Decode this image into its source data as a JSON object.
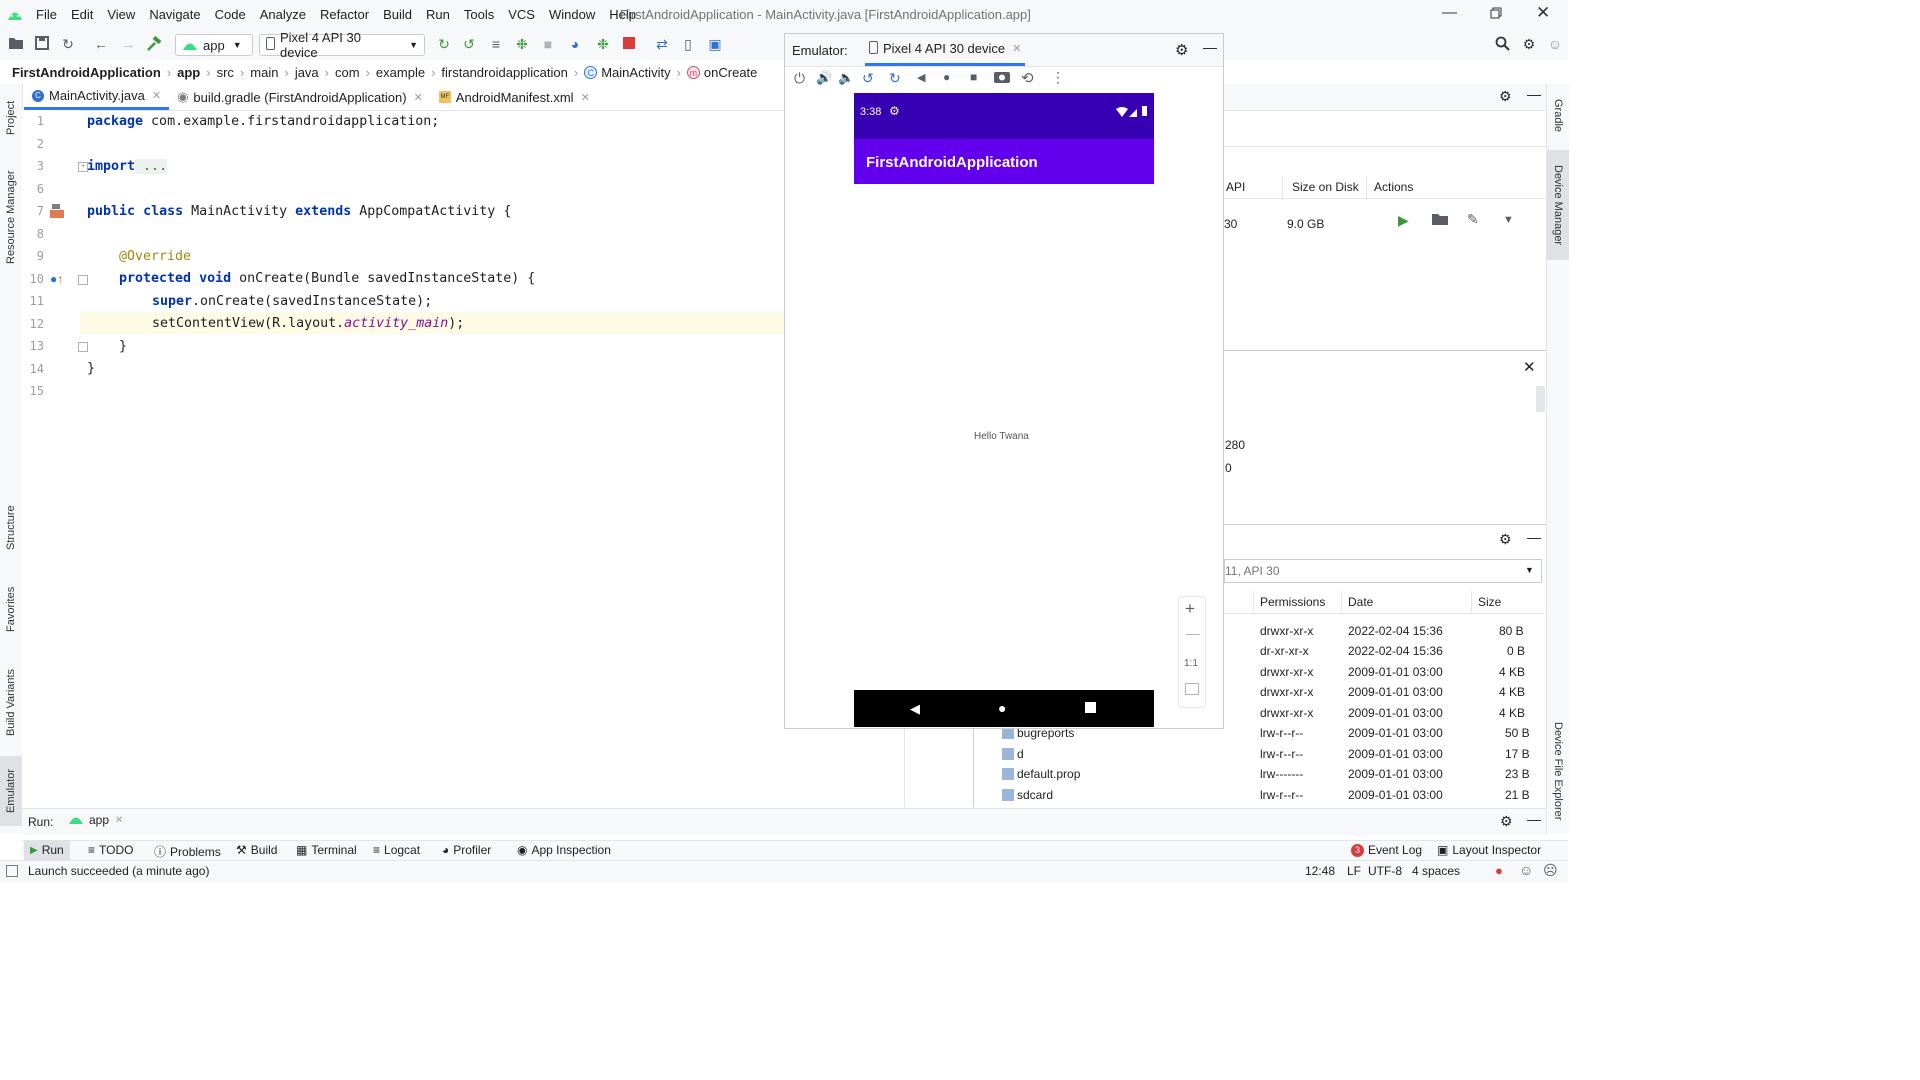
{
  "menu": [
    "File",
    "Edit",
    "View",
    "Navigate",
    "Code",
    "Analyze",
    "Refactor",
    "Build",
    "Run",
    "Tools",
    "VCS",
    "Window",
    "Help"
  ],
  "window_title": "FirstAndroidApplication - MainActivity.java [FirstAndroidApplication.app]",
  "toolbar": {
    "module": "app",
    "device": "Pixel 4 API 30 device"
  },
  "breadcrumb": [
    "FirstAndroidApplication",
    "app",
    "src",
    "main",
    "java",
    "com",
    "example",
    "firstandroidapplication",
    "MainActivity",
    "onCreate"
  ],
  "tabs": [
    "MainActivity.java",
    "build.gradle (FirstAndroidApplication)",
    "AndroidManifest.xml"
  ],
  "left_tools": [
    "Project",
    "Resource Manager",
    "Structure",
    "Favorites",
    "Build Variants",
    "Emulator"
  ],
  "right_tools": [
    "Gradle",
    "Device Manager",
    "Device File Explorer"
  ],
  "code": {
    "line_numbers": [
      "1",
      "2",
      "3",
      "6",
      "7",
      "8",
      "9",
      "10",
      "11",
      "12",
      "13",
      "14",
      "15"
    ],
    "l1_kw": "package",
    "l1_rest": " com.example.firstandroidapplication;",
    "l3_kw": "import",
    "l3_rest": " ...",
    "l7_kw1": "public",
    "l7_kw2": "class",
    "l7_mid": " MainActivity ",
    "l7_kw3": "extends",
    "l7_rest": " AppCompatActivity {",
    "l9_ann": "@Override",
    "l10_kw1": "protected",
    "l10_kw2": "void",
    "l10_rest": " onCreate(Bundle savedInstanceState) {",
    "l11_kw": "super",
    "l11_rest": ".onCreate(savedInstanceState);",
    "l12_pre": "setContentView(R.layout.",
    "l12_ital": "activity_main",
    "l12_post": ");",
    "l13": "}",
    "l14": "}"
  },
  "emulator": {
    "label": "Emulator:",
    "tab": "Pixel 4 API 30 device",
    "time": "3:38",
    "app_title": "FirstAndroidApplication",
    "hello": "Hello Twana",
    "zoom_ratio": "1:1"
  },
  "device_manager": {
    "columns": [
      "API",
      "Size on Disk",
      "Actions"
    ],
    "api_partial": "30",
    "size": "9.0 GB",
    "prop_a": "280",
    "prop_b": "0"
  },
  "file_explorer": {
    "device_select": "11, API 30",
    "columns": [
      "Permissions",
      "Date",
      "Size"
    ],
    "rows": [
      {
        "name": "",
        "perm": "drwxr-xr-x",
        "date": "2022-02-04 15:36",
        "size": "80 B"
      },
      {
        "name": "",
        "perm": "dr-xr-xr-x",
        "date": "2022-02-04 15:36",
        "size": "0 B"
      },
      {
        "name": "",
        "perm": "drwxr-xr-x",
        "date": "2009-01-01 03:00",
        "size": "4 KB"
      },
      {
        "name": "",
        "perm": "drwxr-xr-x",
        "date": "2009-01-01 03:00",
        "size": "4 KB"
      },
      {
        "name": "",
        "perm": "drwxr-xr-x",
        "date": "2009-01-01 03:00",
        "size": "4 KB"
      },
      {
        "name": "bugreports",
        "perm": "lrw-r--r--",
        "date": "2009-01-01 03:00",
        "size": "50 B"
      },
      {
        "name": "d",
        "perm": "lrw-r--r--",
        "date": "2009-01-01 03:00",
        "size": "17 B"
      },
      {
        "name": "default.prop",
        "perm": "lrw-------",
        "date": "2009-01-01 03:00",
        "size": "23 B"
      },
      {
        "name": "sdcard",
        "perm": "lrw-r--r--",
        "date": "2009-01-01 03:00",
        "size": "21 B"
      }
    ]
  },
  "run_panel": {
    "label": "Run:",
    "config": "app"
  },
  "bottom_tabs": [
    "Run",
    "TODO",
    "Problems",
    "Build",
    "Terminal",
    "Logcat",
    "Profiler",
    "App Inspection"
  ],
  "bottom_right": [
    "Event Log",
    "Layout Inspector"
  ],
  "event_count": "3",
  "status": {
    "message": "Launch succeeded (a minute ago)",
    "position": "12:48",
    "line_sep": "LF",
    "encoding": "UTF-8",
    "indent": "4 spaces"
  }
}
